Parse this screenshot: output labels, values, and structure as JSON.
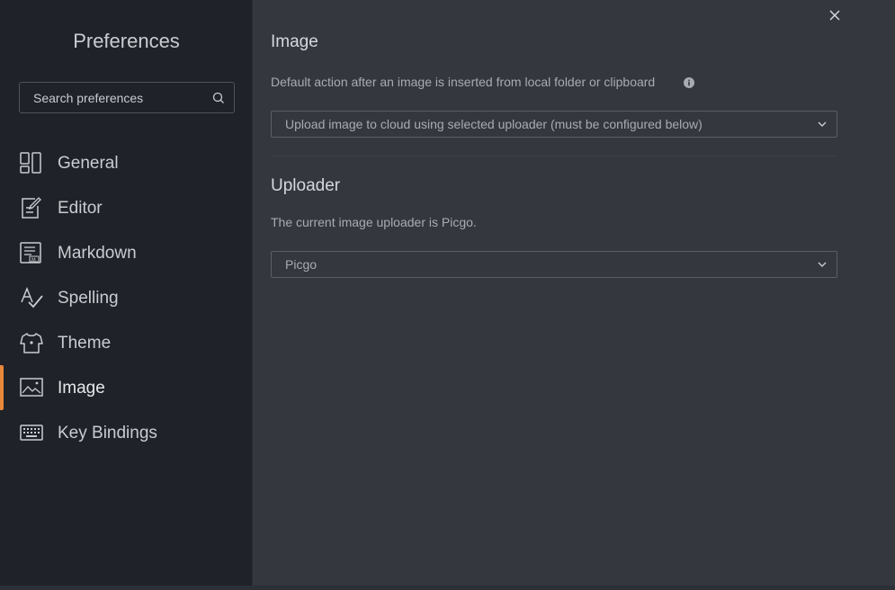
{
  "sidebar": {
    "title": "Preferences",
    "search": {
      "placeholder": "Search preferences",
      "value": ""
    },
    "items": [
      {
        "label": "General",
        "icon": "general-icon"
      },
      {
        "label": "Editor",
        "icon": "editor-icon"
      },
      {
        "label": "Markdown",
        "icon": "markdown-icon"
      },
      {
        "label": "Spelling",
        "icon": "spelling-icon"
      },
      {
        "label": "Theme",
        "icon": "theme-icon"
      },
      {
        "label": "Image",
        "icon": "image-icon",
        "active": true
      },
      {
        "label": "Key Bindings",
        "icon": "keyboard-icon"
      }
    ],
    "accent_color": "#e8883a"
  },
  "main": {
    "image_section": {
      "title": "Image",
      "description": "Default action after an image is inserted from local folder or clipboard",
      "select_value": "Upload image to cloud using selected uploader (must be configured below)"
    },
    "uploader_section": {
      "title": "Uploader",
      "description": "The current image uploader is Picgo.",
      "select_value": "Picgo"
    }
  }
}
